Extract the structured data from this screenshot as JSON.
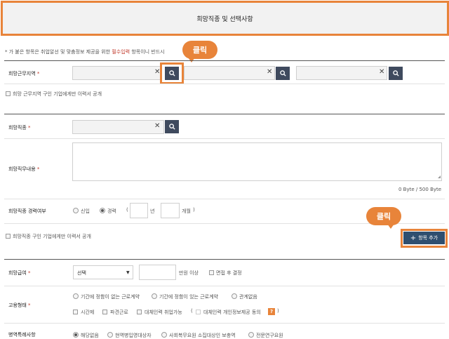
{
  "header": {
    "title": "희망직종 및 선택사항"
  },
  "notice": {
    "prefix": "* 가 붙은 항목은 취업알선 및 맞춤정보 제공을 위한 ",
    "highlight": "필수입력",
    "suffix": " 항목이니 반드시 ",
    "colors": {
      "highlight": "#c0392b"
    }
  },
  "callouts": {
    "top": "클릭",
    "bottom": "클릭",
    "color": "#e8843a"
  },
  "region": {
    "label": "희망근무지역",
    "required_mark": "*",
    "private_option": "희망 근무지역 구인 기업에게만 이력서 공개"
  },
  "job": {
    "label": "희망직종",
    "required_mark": "*",
    "duty_label": "희망직무내용",
    "duty_required_mark": "*",
    "byte_counter": "0 Byte / 500 Byte",
    "career_label": "희망직종 경력여부",
    "career_new": "신입",
    "career_exp": "경력",
    "paren_open": "(",
    "years_unit": "년",
    "months_unit": "개월",
    "paren_close": ")",
    "private_option": "희망직종 구인 기업에게만 이력서 공개",
    "add_button": "항목 추가"
  },
  "salary": {
    "label": "희망급여",
    "required_mark": "*",
    "select_value": "선택",
    "unit": "만원 이상",
    "negotiable": "면접 후 결정"
  },
  "employment": {
    "label": "고용형태",
    "required_mark": "*",
    "radio_options": [
      "기간에 정함이 없는 근로계약",
      "기간에 정함이 있는 근로계약",
      "관계없음"
    ],
    "check_options": [
      "시간제",
      "파견근로",
      "대체인력 취업가능"
    ],
    "paren_open": "(",
    "agree_option": "대체인력 개인정보제공 동의",
    "info_icon_text": "?",
    "paren_close": ")"
  },
  "military": {
    "label": "병역특례사항",
    "options": [
      "해당없음",
      "현역병입영대상자",
      "사회복무요원 소집대상인 보충역",
      "전문연구요원"
    ]
  },
  "icons": {
    "search": "search-icon",
    "clear": "close-icon",
    "plus": "plus-icon",
    "dropdown": "chevron-down-icon"
  }
}
